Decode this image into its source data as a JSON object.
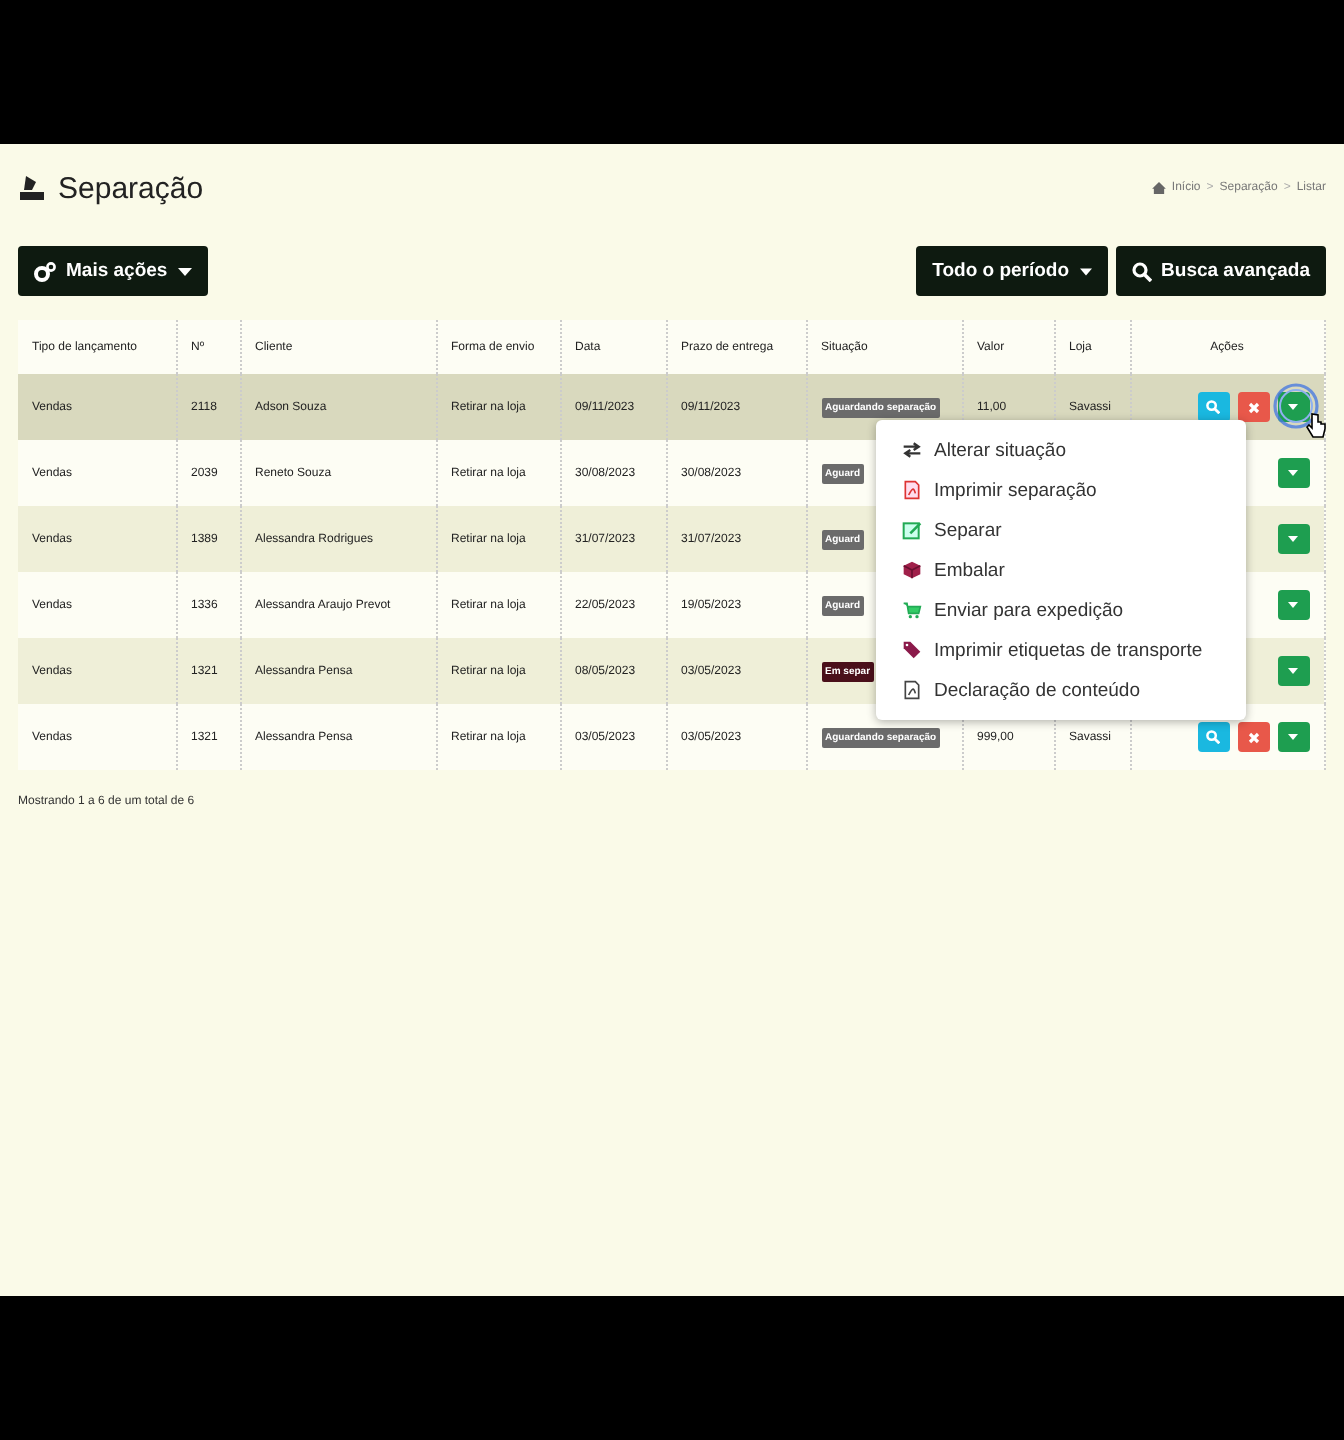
{
  "page": {
    "title": "Separação",
    "breadcrumb": [
      "Início",
      "Separação",
      "Listar"
    ],
    "separator": ">"
  },
  "toolbar": {
    "left": [
      {
        "label": "Mais ações"
      }
    ],
    "right": [
      {
        "label": "Todo o período",
        "kind": "dropdown"
      },
      {
        "label": "Busca avançada",
        "kind": "search"
      }
    ]
  },
  "table": {
    "columns": [
      "Tipo de lançamento",
      "Nº",
      "Cliente",
      "Forma de envio",
      "Data",
      "Prazo de entrega",
      "Situação",
      "Valor",
      "Loja",
      "Ações"
    ],
    "rows": [
      {
        "selected": true,
        "type": "Vendas",
        "number": "2118",
        "client": "Adson Souza",
        "shipping": "Retirar na loja",
        "date": "09/11/2023",
        "deadline": "09/11/2023",
        "status": "Aguardando separação",
        "color": "#6b6b6b",
        "value": "11,00",
        "store": "Savassi",
        "actions": [
          {
            "kind": "view"
          },
          {
            "kind": "delete"
          },
          {
            "kind": "more"
          }
        ]
      },
      {
        "selected": false,
        "type": "Vendas",
        "number": "2039",
        "client": "Reneto Souza",
        "shipping": "Retirar na loja",
        "date": "30/08/2023",
        "deadline": "30/08/2023",
        "status": "Aguard",
        "color": "#6b6b6b",
        "actions": [
          {
            "kind": "more"
          }
        ]
      },
      {
        "selected": false,
        "type": "Vendas",
        "number": "1389",
        "client": "Alessandra Rodrigues",
        "shipping": "Retirar na loja",
        "date": "31/07/2023",
        "deadline": "31/07/2023",
        "status": "Aguard",
        "color": "#6b6b6b",
        "actions": [
          {
            "kind": "more"
          }
        ]
      },
      {
        "selected": false,
        "type": "Vendas",
        "number": "1336",
        "client": "Alessandra Araujo Prevot",
        "shipping": "Retirar na loja",
        "date": "22/05/2023",
        "deadline": "19/05/2023",
        "status": "Aguard",
        "color": "#6b6b6b",
        "actions": [
          {
            "kind": "more"
          }
        ]
      },
      {
        "selected": false,
        "type": "Vendas",
        "number": "1321",
        "client": "Alessandra Pensa",
        "shipping": "Retirar na loja",
        "date": "08/05/2023",
        "deadline": "03/05/2023",
        "status": "Em separ",
        "color": "#4a0f1a",
        "actions": [
          {
            "kind": "more"
          }
        ]
      },
      {
        "selected": false,
        "type": "Vendas",
        "number": "1321",
        "client": "Alessandra Pensa",
        "shipping": "Retirar na loja",
        "date": "03/05/2023",
        "deadline": "03/05/2023",
        "status": "Aguardando separação",
        "color": "#6b6b6b",
        "value": "999,00",
        "store": "Savassi",
        "actions": [
          {
            "kind": "view"
          },
          {
            "kind": "delete"
          },
          {
            "kind": "more"
          }
        ]
      }
    ],
    "footer": "Mostrando 1 a 6 de um total de 6"
  },
  "menu": {
    "items": [
      {
        "label": "Alterar situação",
        "kind": "swap"
      },
      {
        "label": "Imprimir separação",
        "kind": "pdf"
      },
      {
        "label": "Separar",
        "kind": "edit"
      },
      {
        "label": "Embalar",
        "kind": "box"
      },
      {
        "label": "Enviar para expedição",
        "kind": "cart"
      },
      {
        "label": "Imprimir etiquetas de transporte",
        "kind": "tag"
      },
      {
        "label": "Declaração de conteúdo",
        "kind": "document"
      }
    ]
  }
}
